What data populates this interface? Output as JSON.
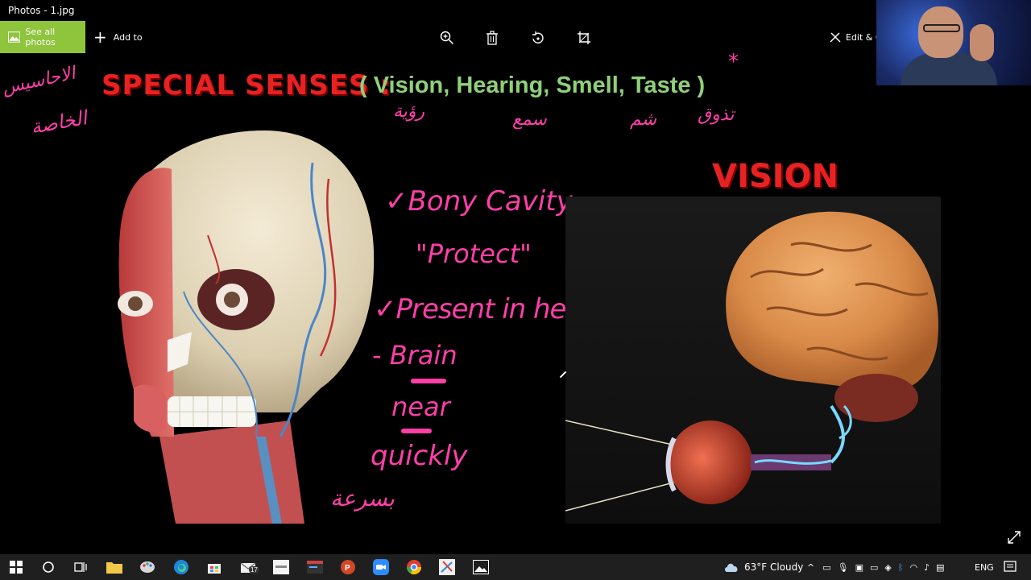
{
  "window": {
    "title": "Photos - 1.jpg"
  },
  "toolbar": {
    "see_all_label": "See all photos",
    "add_to_label": "Add to",
    "edit_create_label": "Edit & C"
  },
  "slide": {
    "heading_main": "SPECIAL SENSES :",
    "heading_list": "( Vision, Hearing, Smell, Taste )",
    "vision_title": "VISION"
  },
  "annotations": {
    "arabic_left_1": "الاحاسيس",
    "arabic_left_2": "الخاصة",
    "arabic_vision": "رؤية",
    "arabic_hearing": "سمع",
    "arabic_smell": "شم",
    "arabic_taste": "تذوق",
    "star": "*",
    "note_bony_cavity": "✓Bony Cavity",
    "note_protect": "\"Protect\"",
    "note_present": "✓Present in head",
    "note_brain": "- Brain",
    "note_near": "near",
    "note_quickly": "quickly",
    "arabic_quickly": "بسرعة"
  },
  "taskbar": {
    "weather": "63°F Cloudy",
    "language": "ENG",
    "mail_badge": "17"
  },
  "colors": {
    "accent_green": "#8fc43d",
    "heading_red": "#e62222",
    "heading_green": "#8fd07a",
    "annotation_pink": "#ff3fa8"
  }
}
